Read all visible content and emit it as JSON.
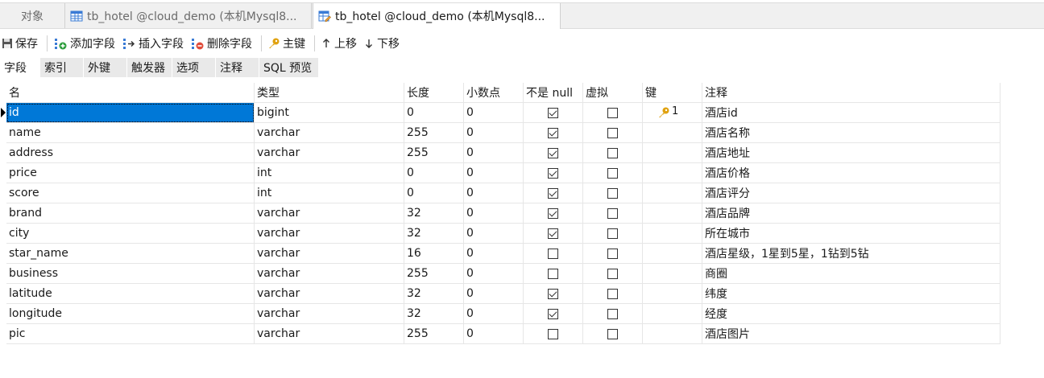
{
  "tabs": [
    {
      "label": "对象"
    },
    {
      "label": "tb_hotel @cloud_demo (本机Mysql8..."
    },
    {
      "label": "tb_hotel @cloud_demo (本机Mysql8..."
    }
  ],
  "toolbar": {
    "save": "保存",
    "add_field": "添加字段",
    "insert_field": "插入字段",
    "delete_field": "删除字段",
    "primary_key": "主键",
    "move_up": "上移",
    "move_down": "下移"
  },
  "subtabs": [
    "字段",
    "索引",
    "外键",
    "触发器",
    "选项",
    "注释",
    "SQL 预览"
  ],
  "columns": [
    "名",
    "类型",
    "长度",
    "小数点",
    "不是 null",
    "虚拟",
    "键",
    "注释"
  ],
  "fields": [
    {
      "name": "id",
      "type": "bigint",
      "length": "0",
      "decimals": "0",
      "not_null": true,
      "virtual": false,
      "key": "1",
      "comment": "酒店id"
    },
    {
      "name": "name",
      "type": "varchar",
      "length": "255",
      "decimals": "0",
      "not_null": true,
      "virtual": false,
      "key": "",
      "comment": "酒店名称"
    },
    {
      "name": "address",
      "type": "varchar",
      "length": "255",
      "decimals": "0",
      "not_null": true,
      "virtual": false,
      "key": "",
      "comment": "酒店地址"
    },
    {
      "name": "price",
      "type": "int",
      "length": "0",
      "decimals": "0",
      "not_null": true,
      "virtual": false,
      "key": "",
      "comment": "酒店价格"
    },
    {
      "name": "score",
      "type": "int",
      "length": "0",
      "decimals": "0",
      "not_null": true,
      "virtual": false,
      "key": "",
      "comment": "酒店评分"
    },
    {
      "name": "brand",
      "type": "varchar",
      "length": "32",
      "decimals": "0",
      "not_null": true,
      "virtual": false,
      "key": "",
      "comment": "酒店品牌"
    },
    {
      "name": "city",
      "type": "varchar",
      "length": "32",
      "decimals": "0",
      "not_null": true,
      "virtual": false,
      "key": "",
      "comment": "所在城市"
    },
    {
      "name": "star_name",
      "type": "varchar",
      "length": "16",
      "decimals": "0",
      "not_null": false,
      "virtual": false,
      "key": "",
      "comment": "酒店星级，1星到5星，1钻到5钻"
    },
    {
      "name": "business",
      "type": "varchar",
      "length": "255",
      "decimals": "0",
      "not_null": false,
      "virtual": false,
      "key": "",
      "comment": "商圈"
    },
    {
      "name": "latitude",
      "type": "varchar",
      "length": "32",
      "decimals": "0",
      "not_null": true,
      "virtual": false,
      "key": "",
      "comment": "纬度"
    },
    {
      "name": "longitude",
      "type": "varchar",
      "length": "32",
      "decimals": "0",
      "not_null": true,
      "virtual": false,
      "key": "",
      "comment": "经度"
    },
    {
      "name": "pic",
      "type": "varchar",
      "length": "255",
      "decimals": "0",
      "not_null": false,
      "virtual": false,
      "key": "",
      "comment": "酒店图片"
    }
  ],
  "colors": {
    "selection": "#0078d7",
    "key_icon": "#e0a10e"
  }
}
